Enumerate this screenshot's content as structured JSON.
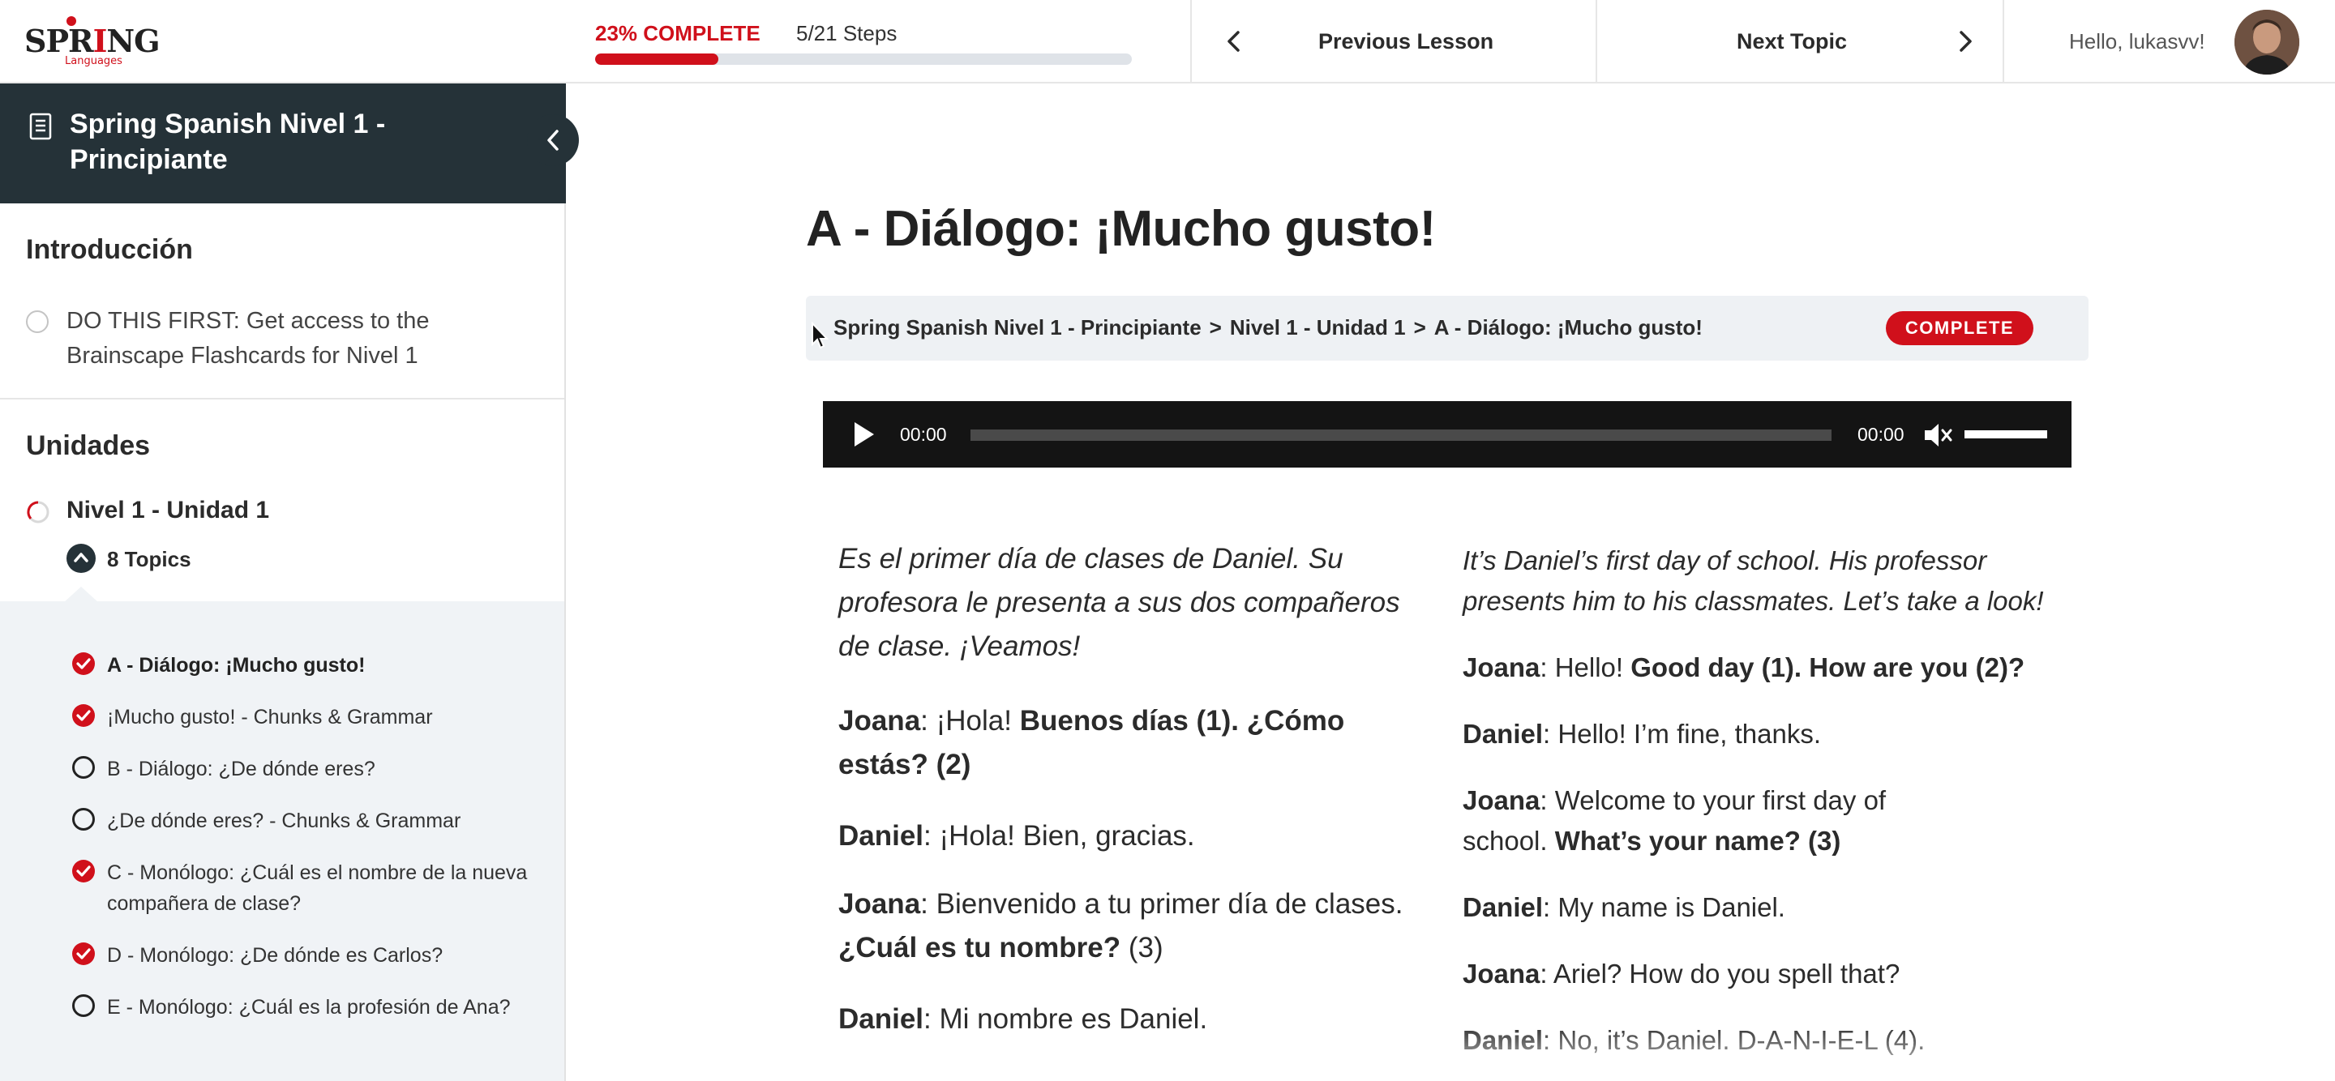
{
  "brand": {
    "logo_text_pre": "SPR",
    "logo_text_i": "I",
    "logo_text_post": "NG",
    "logo_sub": "Languages"
  },
  "header": {
    "progress_label": "23% COMPLETE",
    "progress_percent": 23,
    "steps": "5/21 Steps",
    "prev_label": "Previous Lesson",
    "next_label": "Next Topic",
    "greeting": "Hello, lukasvv!"
  },
  "colors": {
    "accent": "#d0101b",
    "dark": "#253238",
    "panel": "#f0f3f6"
  },
  "sidebar": {
    "course_title": "Spring Spanish Nivel 1 - Principiante",
    "intro_heading": "Introducción",
    "intro_item": "DO THIS FIRST: Get access to the Brainscape Flashcards for Nivel 1",
    "units_heading": "Unidades",
    "lesson": "Nivel 1 - Unidad 1",
    "topics_count": "8 Topics",
    "topics": [
      {
        "label": "A - Diálogo: ¡Mucho gusto!",
        "done": true
      },
      {
        "label": "¡Mucho gusto! - Chunks & Grammar",
        "done": true
      },
      {
        "label": "B - Diálogo: ¿De dónde eres?",
        "done": false
      },
      {
        "label": "¿De dónde eres? - Chunks & Grammar",
        "done": false
      },
      {
        "label": "C - Monólogo: ¿Cuál es el nombre de la nueva compañera de clase?",
        "done": true
      },
      {
        "label": "D - Monólogo: ¿De dónde es Carlos?",
        "done": true
      },
      {
        "label": "E - Monólogo: ¿Cuál es la profesión de Ana?",
        "done": false
      }
    ]
  },
  "main": {
    "title": "A - Diálogo: ¡Mucho gusto!",
    "breadcrumb": [
      "Spring Spanish Nivel 1 - Principiante",
      "Nivel 1 - Unidad 1",
      "A - Diálogo: ¡Mucho gusto!"
    ],
    "breadcrumb_sep": ">",
    "status_badge": "COMPLETE",
    "player": {
      "current_time": "00:00",
      "duration": "00:00"
    },
    "spanish": {
      "intro": "Es el primer día de clases de Daniel. Su profesora le presenta a sus dos compañeros de clase. ¡Veamos!",
      "l1_speaker": "Joana",
      "l1_plain": ": ¡Hola! ",
      "l1_bold": "Buenos días (1). ¿Cómo estás? (2)",
      "l2_speaker": "Daniel",
      "l2_plain": ": ¡Hola! Bien, gracias.",
      "l3_speaker": "Joana",
      "l3_plain": ": Bienvenido a tu primer día de clases. ",
      "l3_bold": "¿Cuál es tu nombre?",
      "l3_tail": " (3)",
      "l4_speaker": "Daniel",
      "l4_plain": ": Mi nombre es Daniel."
    },
    "english": {
      "intro": "It’s Daniel’s first day of school. His professor presents him to his classmates. Let’s take a look!",
      "l1_speaker": "Joana",
      "l1_plain": ": Hello! ",
      "l1_bold": "Good day (1). How are you (2)?",
      "l2_speaker": "Daniel",
      "l2_plain": ": Hello! I’m fine, thanks.",
      "l3_speaker": "Joana",
      "l3_plain": ": Welcome to your first day of school. ",
      "l3_bold": "What’s your name? (3)",
      "l4_speaker": "Daniel",
      "l4_plain": ": My name is Daniel.",
      "l5_speaker": "Joana",
      "l5_plain": ": Ariel? How do you spell that?",
      "l6_speaker": "Daniel",
      "l6_plain": ": No, it’s Daniel. D-A-N-I-E-L (4)."
    }
  }
}
